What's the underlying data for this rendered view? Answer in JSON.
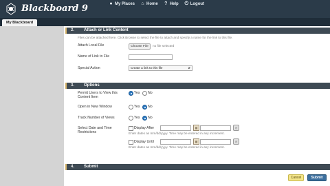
{
  "header": {
    "brand": "Blackboard 9",
    "nav": [
      {
        "label": "My Places",
        "icon": "person-icon"
      },
      {
        "label": "Home",
        "icon": "home-icon"
      },
      {
        "label": "Help",
        "icon": "help-icon"
      },
      {
        "label": "Logout",
        "icon": "power-icon"
      }
    ]
  },
  "tabs": [
    {
      "label": "My Blackboard"
    }
  ],
  "sections": {
    "attach": {
      "num": "2.",
      "title": "Attach or Link Content",
      "intro": "Files can be attached here. Click Browse to select the file to attach and specify a name for the link to this file.",
      "attach_local_label": "Attach Local File",
      "choose_btn": "Choose File",
      "no_file": "no file selected",
      "link_name_label": "Name of Link to File",
      "link_name_value": "",
      "special_action_label": "Special Action",
      "special_action_value": "Create a link to this file"
    },
    "options": {
      "num": "3.",
      "title": "Options",
      "permit_label": "Permit Users to View this Content Item",
      "permit_yes": "Yes",
      "permit_no": "No",
      "permit_selected": "Yes",
      "new_window_label": "Open in New Window",
      "new_window_yes": "Yes",
      "new_window_no": "No",
      "new_window_selected": "No",
      "track_label": "Track Number of Views",
      "track_yes": "Yes",
      "track_no": "No",
      "track_selected": "No",
      "dates_label": "Select Date and Time Restrictions",
      "display_after": "Display After",
      "display_after_hint": "Enter dates as mm/dd/yyyy. Time may be entered in any increment.",
      "display_until": "Display Until",
      "display_until_hint": "Enter dates as mm/dd/yyyy. Time may be entered in any increment."
    },
    "submit": {
      "num": "4.",
      "title": "Submit"
    }
  },
  "buttons": {
    "cancel": "Cancel",
    "submit": "Submit"
  },
  "colors": {
    "header_bg": "#2b3b49",
    "section_bar": "#3e4a54",
    "accent_gold": "#d6b46a",
    "submit_blue": "#3c6f9e",
    "cancel_yellow": "#f4e58a"
  }
}
